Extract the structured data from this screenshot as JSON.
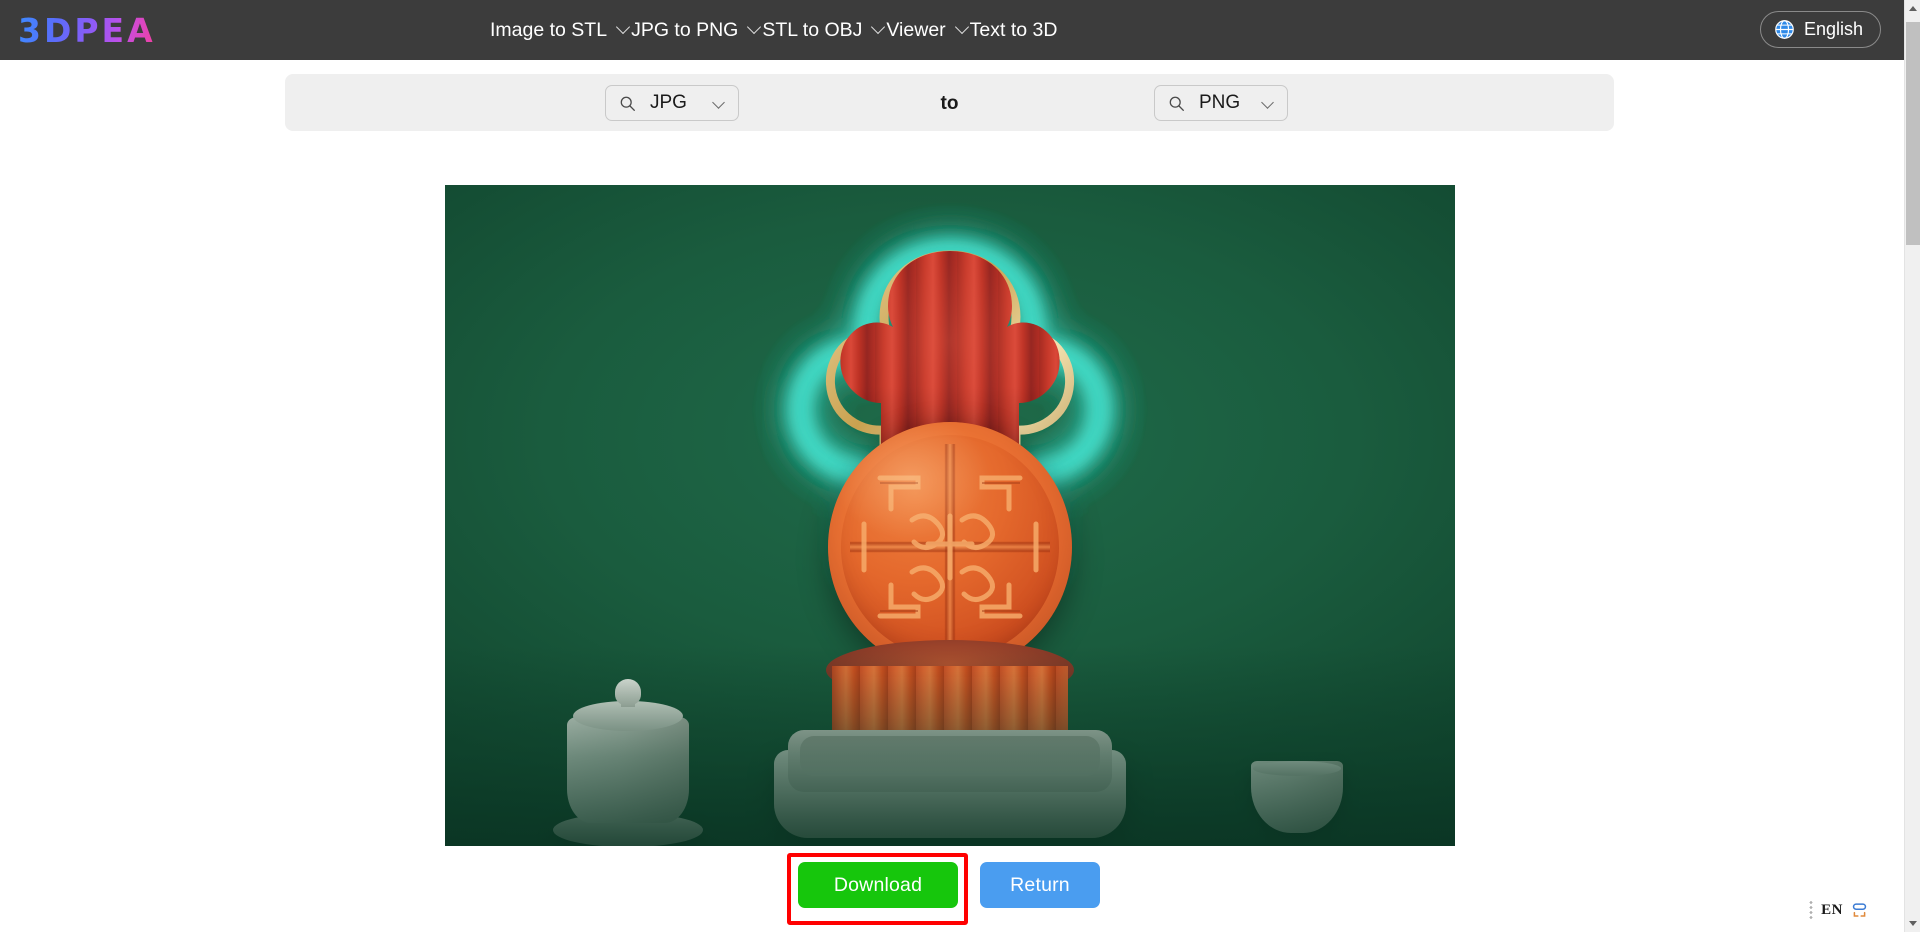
{
  "nav": {
    "logo": "3DPEA",
    "items": [
      {
        "label": "Image to STL",
        "has_dropdown": true
      },
      {
        "label": "JPG to PNG",
        "has_dropdown": true
      },
      {
        "label": "STL to OBJ",
        "has_dropdown": true
      },
      {
        "label": "Viewer",
        "has_dropdown": true
      },
      {
        "label": "Text to 3D",
        "has_dropdown": false
      }
    ],
    "language": {
      "label": "English",
      "icon": "globe-icon"
    }
  },
  "converter": {
    "source": {
      "value": "JPG",
      "search_icon": "search-icon",
      "dropdown_icon": "chevron-down-icon"
    },
    "separator": "to",
    "target": {
      "value": "PNG",
      "search_icon": "search-icon",
      "dropdown_icon": "chevron-down-icon"
    }
  },
  "preview": {
    "alt": "Mid-Autumn Festival mooncake scene on green background",
    "colors": {
      "background_green": "#1a5c3e",
      "neon_cyan": "#7ef4e4",
      "curtain_red": "#c23a2c",
      "mooncake_orange": "#e4682c",
      "gold": "#c9a14f",
      "ceramic": "#dfe2db"
    }
  },
  "actions": {
    "download": {
      "label": "Download",
      "color": "#16c60c",
      "highlighted": true,
      "highlight_color": "#ff0000"
    },
    "return": {
      "label": "Return",
      "color": "#4a9df0"
    }
  },
  "ime": {
    "language_code": "EN",
    "grip_icon": "drag-handle-icon",
    "mode_icon": "ime-mode-icon"
  },
  "scrollbar": {
    "up_icon": "scroll-up-arrow-icon",
    "down_icon": "scroll-down-arrow-icon",
    "thumb": "scroll-thumb"
  }
}
